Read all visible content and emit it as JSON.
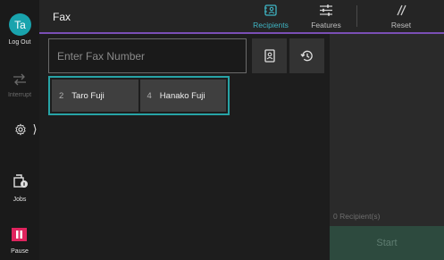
{
  "app": {
    "title": "Fax"
  },
  "rail": {
    "user_initials": "Ta",
    "logout_label": "Log Out",
    "interrupt_label": "Interrupt",
    "jobs_label": "Jobs",
    "pause_label": "Pause",
    "chevron": "⟩"
  },
  "tabs": [
    {
      "label": "Recipients",
      "icon": "address-card-icon",
      "active": true
    },
    {
      "label": "Features",
      "icon": "sliders-icon",
      "active": false
    },
    {
      "label": "Reset",
      "icon": "reset-slashes-icon",
      "active": false
    }
  ],
  "fax": {
    "placeholder": "Enter Fax Number"
  },
  "recipients": [
    {
      "number": "2",
      "name": "Taro Fuji"
    },
    {
      "number": "4",
      "name": "Hanako Fuji"
    }
  ],
  "summary": {
    "count_label": "0 Recipient(s)",
    "start_label": "Start"
  },
  "colors": {
    "accent_teal": "#3fb5c4",
    "header_underline": "#7a4fb5",
    "avatar": "#19a3ad",
    "pause": "#e0245e",
    "start_bg": "#2d4a3e"
  }
}
